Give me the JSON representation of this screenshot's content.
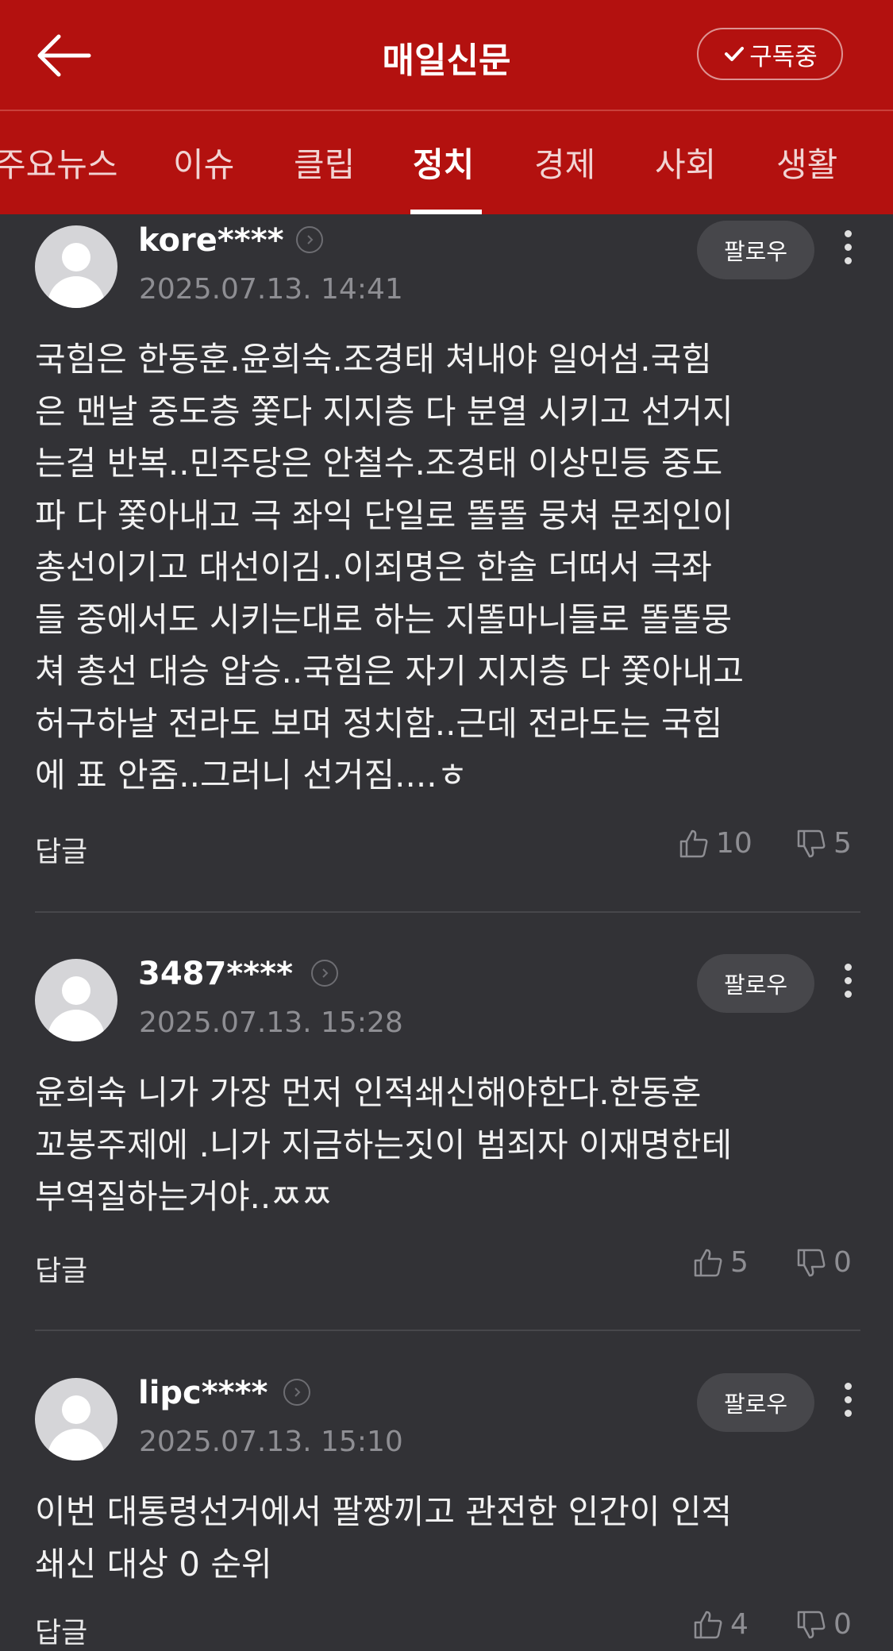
{
  "header": {
    "title": "매일신문",
    "subscribe_label": "구독중"
  },
  "tabs": [
    {
      "label": "주요뉴스"
    },
    {
      "label": "이슈"
    },
    {
      "label": "클립"
    },
    {
      "label": "정치",
      "active": true
    },
    {
      "label": "경제"
    },
    {
      "label": "사회"
    },
    {
      "label": "생활"
    }
  ],
  "comments": [
    {
      "user": "kore****",
      "date": "2025.07.13. 14:41",
      "follow_label": "팔로우",
      "text": "국힘은 한동훈.윤희숙.조경태 쳐내야 일어섬.국힘\n은 맨날 중도층 쫓다 지지층 다 분열 시키고 선거지\n는걸 반복..민주당은 안철수.조경태 이상민등 중도\n파 다 쫓아내고 극 좌익 단일로 똘똘 뭉쳐 문죄인이\n총선이기고 대선이김..이죄명은 한술 더떠서 극좌\n들 중에서도 시키는대로 하는 지똘마니들로 똘똘뭉\n쳐 총선 대승 압승..국힘은 자기 지지층 다 쫓아내고\n허구하날 전라도 보며 정치함..근데 전라도는 국힘\n에 표 안줌..그러니 선거짐....ㅎ",
      "reply_label": "답글",
      "likes": "10",
      "dislikes": "5"
    },
    {
      "user": "3487****",
      "date": "2025.07.13. 15:28",
      "follow_label": "팔로우",
      "text": "윤희숙 니가 가장 먼저 인적쇄신해야한다.한동훈\n꼬봉주제에 .니가 지금하는짓이 범죄자 이재명한테\n부역질하는거야..ㅉㅉ",
      "reply_label": "답글",
      "likes": "5",
      "dislikes": "0"
    },
    {
      "user": "lipc****",
      "date": "2025.07.13. 15:10",
      "follow_label": "팔로우",
      "text": "이번 대통령선거에서 팔짱끼고 관전한 인간이 인적\n쇄신 대상 0 순위",
      "reply_label": "답글",
      "likes": "4",
      "dislikes": "0"
    }
  ]
}
